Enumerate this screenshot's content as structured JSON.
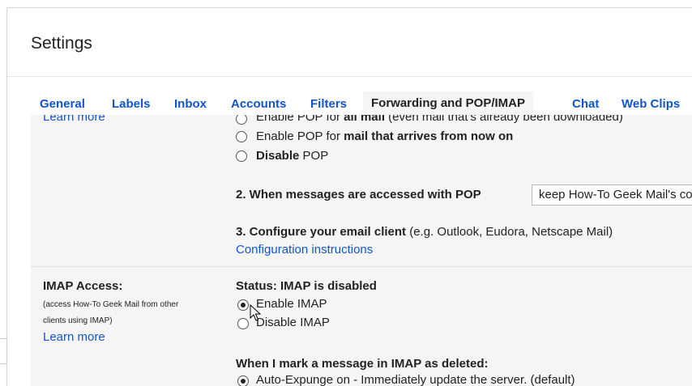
{
  "page": {
    "title": "Settings"
  },
  "tabs": [
    {
      "label": "General"
    },
    {
      "label": "Labels"
    },
    {
      "label": "Inbox"
    },
    {
      "label": "Accounts"
    },
    {
      "label": "Filters"
    },
    {
      "label": "Forwarding and POP/IMAP",
      "active": true
    },
    {
      "label": "Chat"
    },
    {
      "label": "Web Clips"
    }
  ],
  "pop": {
    "learn_more": "Learn more",
    "option_all": {
      "pre": "Enable POP for ",
      "bold": "all mail",
      "post": " (even mail that's already been downloaded)"
    },
    "option_now": {
      "pre": "Enable POP for ",
      "bold": "mail that arrives from now on"
    },
    "option_disable": {
      "bold": "Disable",
      "post": " POP"
    },
    "step2_label": "2. When messages are accessed with POP",
    "step2_select_value": "keep How-To Geek Mail's copy in the Inbox",
    "step3_label": "3. Configure your email client",
    "step3_hint": " (e.g. Outlook, Eudora, Netscape Mail)",
    "config_link": "Configuration instructions"
  },
  "imap": {
    "heading": "IMAP Access:",
    "desc_line1": "(access How-To Geek Mail from other",
    "desc_line2": "clients using IMAP)",
    "learn_more": "Learn more",
    "status": "Status: IMAP is disabled",
    "enable_label": "Enable IMAP",
    "disable_label": "Disable IMAP",
    "deleted_heading": "When I mark a message in IMAP as deleted:",
    "auto_expunge_label": "Auto-Expunge on - Immediately update the server. (default)"
  },
  "colors": {
    "link": "#1155cc",
    "panel_bg": "#f5f5f5",
    "text": "#222222"
  }
}
